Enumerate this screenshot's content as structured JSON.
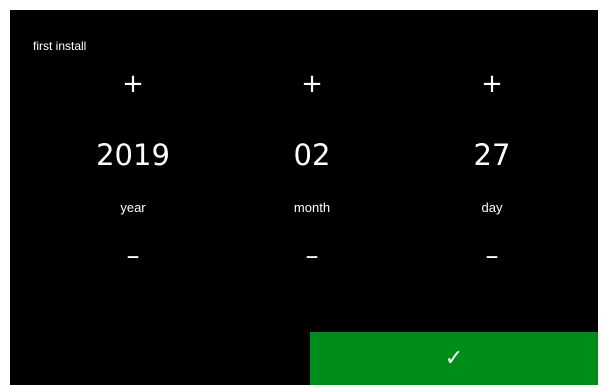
{
  "screen": {
    "title": "first install"
  },
  "year": {
    "increment_icon": "+",
    "value": "2019",
    "label": "year",
    "decrement_icon": "–"
  },
  "month": {
    "increment_icon": "+",
    "value": "02",
    "label": "month",
    "decrement_icon": "–"
  },
  "day": {
    "increment_icon": "+",
    "value": "27",
    "label": "day",
    "decrement_icon": "–"
  },
  "confirm": {
    "icon": "✓",
    "icon_name": "checkmark-icon"
  },
  "colors": {
    "background": "#000000",
    "text": "#ffffff",
    "confirm_button": "#008c19"
  }
}
